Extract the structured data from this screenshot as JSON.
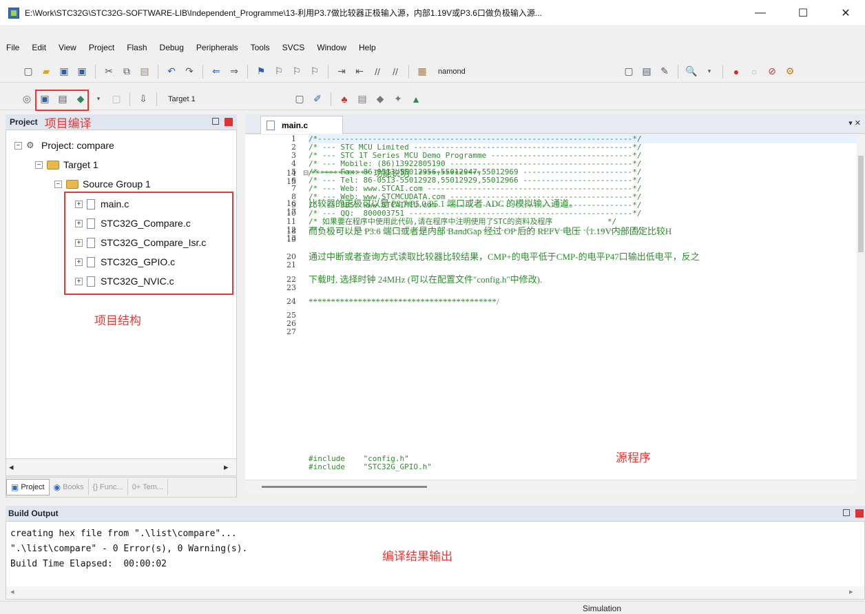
{
  "window": {
    "title": "E:\\Work\\STC32G\\STC32G-SOFTWARE-LIB\\Independent_Programme\\13-利用P3.7做比较器正极输入源，内部1.19V或P3.6口做负极输入源...",
    "min_glyph": "—",
    "max_glyph": "☐",
    "close_glyph": "✕"
  },
  "menu": [
    "File",
    "Edit",
    "View",
    "Project",
    "Flash",
    "Debug",
    "Peripherals",
    "Tools",
    "SVCS",
    "Window",
    "Help"
  ],
  "toolbar1": {
    "search_text": "namond"
  },
  "toolbar2": {
    "target": "Target 1"
  },
  "project_panel": {
    "title": "Project",
    "annotation": "项目编译",
    "tree": {
      "root": "Project: compare",
      "target": "Target 1",
      "group": "Source Group 1",
      "files": [
        "main.c",
        "STC32G_Compare.c",
        "STC32G_Compare_Isr.c",
        "STC32G_GPIO.c",
        "STC32G_NVIC.c"
      ]
    },
    "structure_annotation": "项目结构",
    "tabs": [
      "Project",
      "Books",
      "{} Func...",
      "0+ Tem..."
    ]
  },
  "editor": {
    "tab": "main.c",
    "source_annotation": "源程序",
    "lines": [
      "/*---------------------------------------------------------------------*/",
      "/* --- STC MCU Limited ------------------------------------------------*/",
      "/* --- STC 1T Series MCU Demo Programme -------------------------------*/",
      "/* --- Mobile: (86)13922805190 ----------------------------------------*/",
      "/* --- Fax: 86-0513-55012956,55012947,55012969 ------------------------*/",
      "/* --- Tel: 86-0513-55012928,55012929,55012966 ------------------------*/",
      "/* --- Web: www.STCAI.com ---------------------------------------------*/",
      "/* --- Web: www.STCMCUDATA.com ----------------------------------------*/",
      "/* --- BBS: www.STCAIMCU.com  -----------------------------------------*/",
      "/* --- QQ:  800003751 -------------------------------------------------*/",
      "/* 如果要在程序中使用此代码,请在程序中注明使用了STC的资料及程序            */",
      "/*---------------------------------------------------------------------*/",
      "",
      "/*************  功能说明    **************",
      "",
      "比较器的正极可以是 P3.7/P5.0/P5.1 端口或者 ADC 的模拟输入通道。",
      "",
      "而负极可以是 P3.6 端口或者是内部 BandGap 经过 OP 后的 REFV 电压（1.19V内部固定比较H",
      "",
      "通过中断或者查询方式读取比较器比较结果，CMP+的电平低于CMP-的电平P47口输出低电平，反之",
      "",
      "下载时, 选择时钟 24MHz (可以在配置文件\"config.h\"中修改).",
      "",
      "******************************************/",
      "",
      "#include    \"config.h\"",
      "#include    \"STC32G_GPIO.h\""
    ]
  },
  "build_output": {
    "title": "Build Output",
    "lines": [
      "creating hex file from \".\\list\\compare\"...",
      "\".\\list\\compare\" - 0 Error(s), 0 Warning(s).",
      "Build Time Elapsed:  00:00:02"
    ],
    "annotation": "编译结果输出"
  },
  "status": {
    "mode": "Simulation"
  }
}
